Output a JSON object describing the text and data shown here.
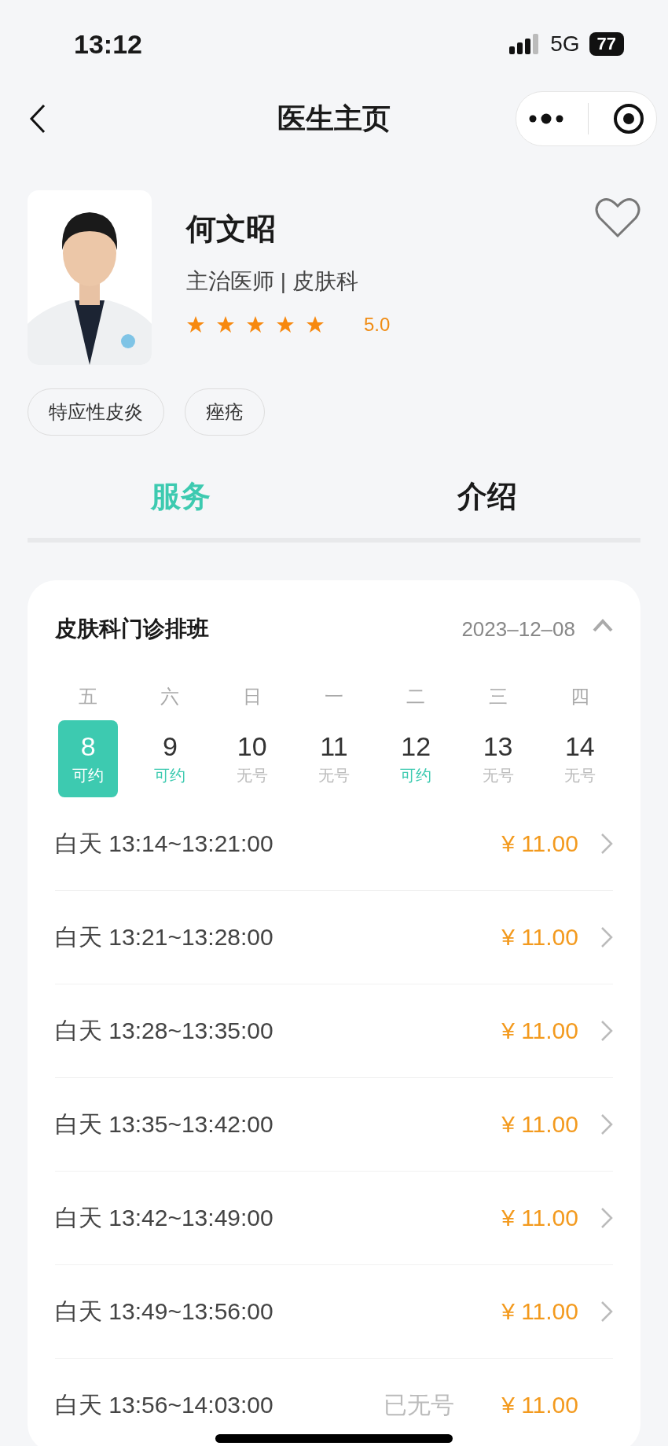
{
  "status_bar": {
    "time": "13:12",
    "network": "5G",
    "battery": "77"
  },
  "nav": {
    "title": "医生主页"
  },
  "doctor": {
    "name": "何文昭",
    "title": "主治医师 | 皮肤科",
    "stars": 5,
    "rating": "5.0",
    "favorite": false
  },
  "tags": [
    "特应性皮炎",
    "痤疮"
  ],
  "tabs": [
    {
      "label": "服务",
      "selected": true
    },
    {
      "label": "介绍",
      "selected": false
    }
  ],
  "schedule": {
    "title": "皮肤科门诊排班",
    "date": "2023–12–08",
    "expanded": true,
    "days": [
      {
        "weekday": "五",
        "date": "8",
        "status": "可约",
        "available": true,
        "selected": true
      },
      {
        "weekday": "六",
        "date": "9",
        "status": "可约",
        "available": true,
        "selected": false
      },
      {
        "weekday": "日",
        "date": "10",
        "status": "无号",
        "available": false,
        "selected": false
      },
      {
        "weekday": "一",
        "date": "11",
        "status": "无号",
        "available": false,
        "selected": false
      },
      {
        "weekday": "二",
        "date": "12",
        "status": "可约",
        "available": true,
        "selected": false
      },
      {
        "weekday": "三",
        "date": "13",
        "status": "无号",
        "available": false,
        "selected": false
      },
      {
        "weekday": "四",
        "date": "14",
        "status": "无号",
        "available": false,
        "selected": false
      }
    ],
    "slots": [
      {
        "kind": "open",
        "time": "白天 13:14~13:21:00",
        "price": "¥ 11.00"
      },
      {
        "kind": "open",
        "time": "白天 13:21~13:28:00",
        "price": "¥ 11.00"
      },
      {
        "kind": "open",
        "time": "白天 13:28~13:35:00",
        "price": "¥ 11.00"
      },
      {
        "kind": "open",
        "time": "白天 13:35~13:42:00",
        "price": "¥ 11.00"
      },
      {
        "kind": "open",
        "time": "白天 13:42~13:49:00",
        "price": "¥ 11.00"
      },
      {
        "kind": "open",
        "time": "白天 13:49~13:56:00",
        "price": "¥ 11.00"
      },
      {
        "kind": "full",
        "time": "白天 13:56~14:03:00",
        "status": "已无号",
        "price": "¥ 11.00"
      }
    ]
  }
}
